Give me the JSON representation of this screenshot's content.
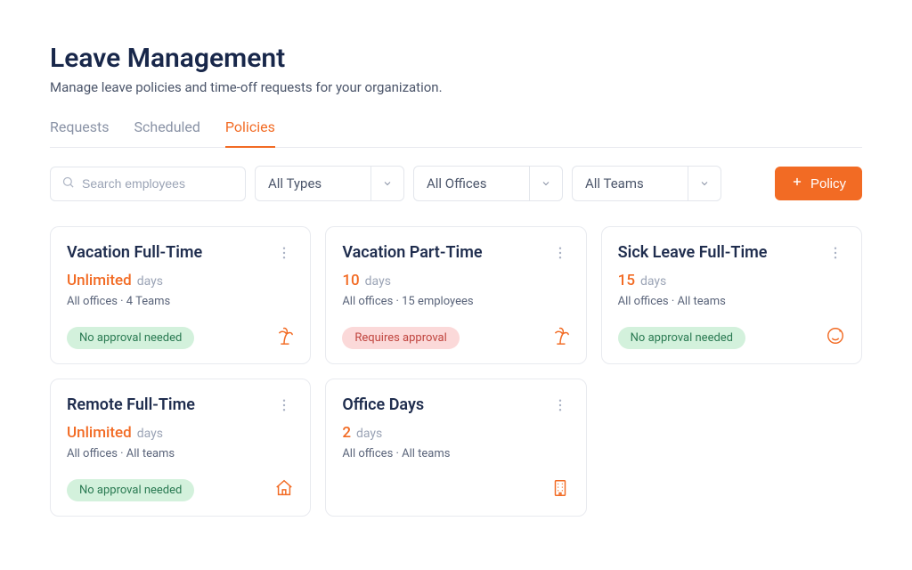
{
  "page": {
    "title": "Leave Management",
    "subtitle": "Manage leave policies and time-off requests for your organization."
  },
  "tabs": [
    {
      "label": "Requests",
      "active": false
    },
    {
      "label": "Scheduled",
      "active": false
    },
    {
      "label": "Policies",
      "active": true
    }
  ],
  "filters": {
    "search_placeholder": "Search employees",
    "types": "All Types",
    "offices": "All Offices",
    "teams": "All Teams"
  },
  "create_button": "Policy",
  "cards": [
    {
      "title": "Vacation Full-Time",
      "amount": "Unlimited",
      "unit": "days",
      "scope": "All offices · 4 Teams",
      "badge": "No approval needed",
      "badge_kind": "ok",
      "icon": "palm"
    },
    {
      "title": "Vacation Part-Time",
      "amount": "10",
      "unit": "days",
      "scope": "All offices · 15 employees",
      "badge": "Requires approval",
      "badge_kind": "warn",
      "icon": "palm"
    },
    {
      "title": "Sick Leave Full-Time",
      "amount": "15",
      "unit": "days",
      "scope": "All offices · All teams",
      "badge": "No approval needed",
      "badge_kind": "ok",
      "icon": "sick"
    },
    {
      "title": "Remote Full-Time",
      "amount": "Unlimited",
      "unit": "days",
      "scope": "All offices · All teams",
      "badge": "No approval needed",
      "badge_kind": "ok",
      "icon": "home"
    },
    {
      "title": "Office Days",
      "amount": "2",
      "unit": "days",
      "scope": "All offices · All teams",
      "badge": "",
      "badge_kind": "",
      "icon": "building"
    }
  ]
}
